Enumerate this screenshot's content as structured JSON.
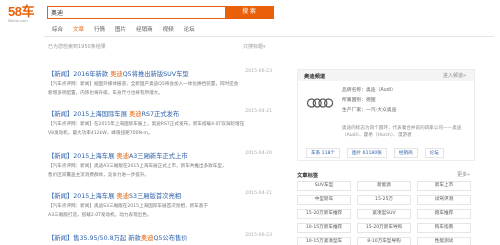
{
  "header": {
    "logo_main": "58车",
    "logo_sub": "58che.com",
    "search_value": "奥迪",
    "search_button": "搜 索"
  },
  "tabs": [
    {
      "label": "综合",
      "active": false
    },
    {
      "label": "文章",
      "active": true
    },
    {
      "label": "行情",
      "active": false
    },
    {
      "label": "图片",
      "active": false
    },
    {
      "label": "经销商",
      "active": false
    },
    {
      "label": "视频",
      "active": false
    },
    {
      "label": "论坛",
      "active": false
    }
  ],
  "summary": {
    "left": "已为您检索到1950条结果",
    "right": "只搜标题",
    "right_arrow": "▾"
  },
  "results": [
    {
      "tag": "【新闻】",
      "title_pre": "2016年新款 ",
      "title_hl": "奥迪",
      "title_post": "Q5将推出新版SUV车型",
      "date": "2015-06-23",
      "snip1": "【汽车点评网：新闻】据国外媒体报道，全新国产奥迪Q5将会加入一体化换挡装置，同时还会",
      "snip2": "新增多项配置，内饰也将升级，车身尺寸也将有所增大。"
    },
    {
      "tag": "【新闻】",
      "title_pre": "2015上海国际车展 ",
      "title_hl": "奥迪",
      "title_post": "RS7正式发布",
      "date": "2015-04-21",
      "snip1": "【汽车点评网：新闻】在2015年上海国际车展上，奥迪RS7正式发布，新车搭载4.0T双涡轮增压",
      "snip2": "V8发动机，最大功率412kW，峰值扭矩700N·m。"
    },
    {
      "tag": "【新闻】",
      "title_pre": "2015上海车展 ",
      "title_hl": "奥迪",
      "title_post": "A3三厢新车正式上市",
      "date": "2015-04-20",
      "snip1": "【汽车点评网：新闻】奥迪A3三厢版在2015上海车展正式上市，新车共推出多款车型，",
      "snip2": "售价区间覆盖主流消费群体，竞争力进一步提升。"
    },
    {
      "tag": "【新闻】",
      "title_pre": "2015上海车展 ",
      "title_hl": "奥迪",
      "title_post": "S3三厢版首次亮相",
      "date": "2015-04-21",
      "snip1": "【汽车点评网：新闻】奥迪S3三厢版在2015上海国际车展首次亮相，新车基于",
      "snip2": "A3三厢版打造，搭载2.0T发动机，动力表现出色。"
    },
    {
      "tag": "【新闻】",
      "title_pre": "售35.95/50.8万起 新款",
      "title_hl": "奥迪",
      "title_post": "Q5公布售价",
      "date": "2015-06-23",
      "snip1": "",
      "snip2": ""
    }
  ],
  "sidebar": {
    "title": "奥迪频道",
    "more": "进入频道»",
    "brand_name": "品牌名称：奥迪（Audi）",
    "brand_country": "所属国别：德国",
    "brand_maker": "生产厂家：一汽-大众奥迪",
    "brand_desc": "奥迪的标志为四个圆环，代表着合并前的四家公司——奥迪（Audi）、霍希（Horch）、漫游者",
    "links": [
      "车系 118个",
      "图片 61180张",
      "经销商",
      "论坛"
    ]
  },
  "tags_section": {
    "title": "文章标签",
    "more": "更多»",
    "tags": [
      "SUV车型",
      "新能源",
      "新车上市",
      "中型轿车",
      "15-25万",
      "试驾评测",
      "15-20万新车推荐",
      "紧凑型SUV",
      "跑车推荐",
      "10-15万新车推荐",
      "15-20万新车导购",
      "购车指南",
      "10-15万紧凑型车",
      "8-10万车型导购",
      "性能测试"
    ]
  },
  "colors": {
    "brand_orange": "#e8600a",
    "link_blue": "#2a5ea8"
  }
}
